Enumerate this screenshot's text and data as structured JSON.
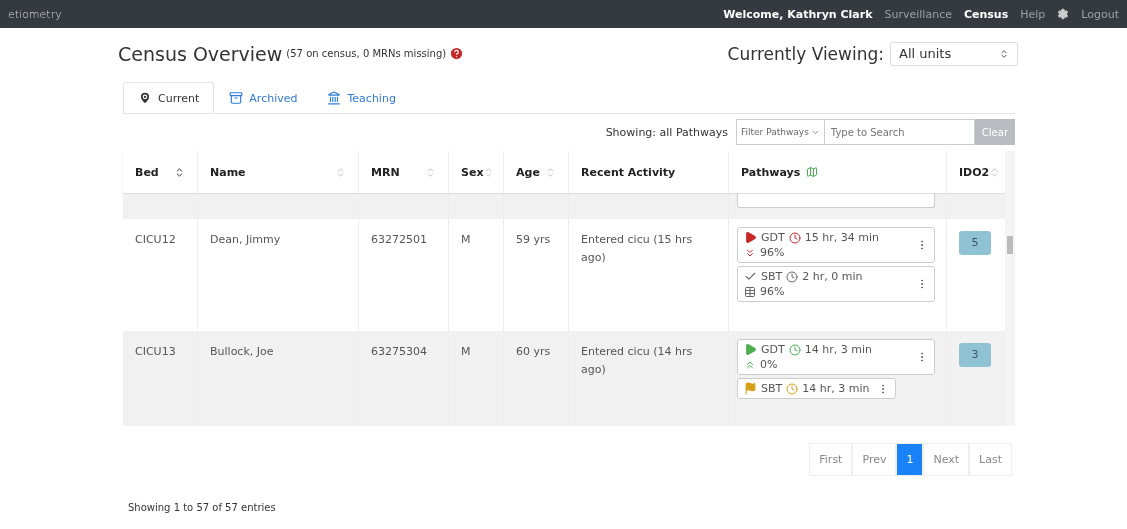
{
  "navbar": {
    "logo": "etiometry",
    "welcome": "Welcome, Kathryn Clark",
    "links": [
      {
        "label": "Surveillance",
        "selected": false
      },
      {
        "label": "Census",
        "selected": true
      },
      {
        "label": "Help",
        "selected": false
      }
    ],
    "logout": "Logout"
  },
  "header": {
    "title": "Census Overview",
    "subtitle": "(57 on census, 0 MRNs missing)",
    "viewing_label": "Currently Viewing:",
    "unit_select": "All units"
  },
  "tabs": [
    {
      "label": "Current",
      "kind": "pin",
      "selected": true
    },
    {
      "label": "Archived",
      "kind": "archive",
      "selected": false
    },
    {
      "label": "Teaching",
      "kind": "bank",
      "selected": false
    }
  ],
  "filter": {
    "showing": "Showing: all Pathways",
    "dropdown": "Filter Pathways",
    "placeholder": "Type to Search",
    "clear": "Clear"
  },
  "table": {
    "columns": [
      {
        "label": "Bed",
        "kind": "sorted"
      },
      {
        "label": "Name",
        "kind": "sortable"
      },
      {
        "label": "MRN",
        "kind": "sortable"
      },
      {
        "label": "Sex",
        "kind": "sortable"
      },
      {
        "label": "Age",
        "kind": "sortable"
      },
      {
        "label": "Recent Activity",
        "kind": "plain"
      },
      {
        "label": "Pathways",
        "kind": "map"
      },
      {
        "label": "IDO2",
        "kind": "sortable"
      }
    ],
    "rows": [
      {
        "bed": "CICU12",
        "name": "Dean, Jimmy",
        "mrn": "63272501",
        "sex": "M",
        "age": "59 yrs",
        "activity": "Entered cicu (15 hrs ago)",
        "ido2": "5",
        "pathways": [
          {
            "kind": "failing",
            "name": "GDT",
            "time": "15 hr, 34 min",
            "trend": {
              "kind": "down",
              "value": "96%"
            }
          },
          {
            "kind": "done",
            "name": "SBT",
            "time": "2 hr, 0 min",
            "trend": {
              "kind": "table",
              "value": "96%"
            }
          }
        ]
      },
      {
        "bed": "CICU13",
        "name": "Bullock, Joe",
        "mrn": "63275304",
        "sex": "M",
        "age": "60 yrs",
        "activity": "Entered cicu (14 hrs ago)",
        "ido2": "3",
        "pathways": [
          {
            "kind": "ok",
            "name": "GDT",
            "time": "14 hr, 3 min",
            "trend": {
              "kind": "up",
              "value": "0%"
            }
          },
          {
            "kind": "warning",
            "name": "SBT",
            "time": "14 hr, 3 min"
          }
        ]
      }
    ]
  },
  "pagination": [
    {
      "label": "First",
      "selected": false
    },
    {
      "label": "Prev",
      "selected": false
    },
    {
      "label": "1",
      "selected": true
    },
    {
      "label": "Next",
      "selected": false
    },
    {
      "label": "Last",
      "selected": false
    }
  ],
  "entries": "Showing 1 to 57 of 57 entries"
}
